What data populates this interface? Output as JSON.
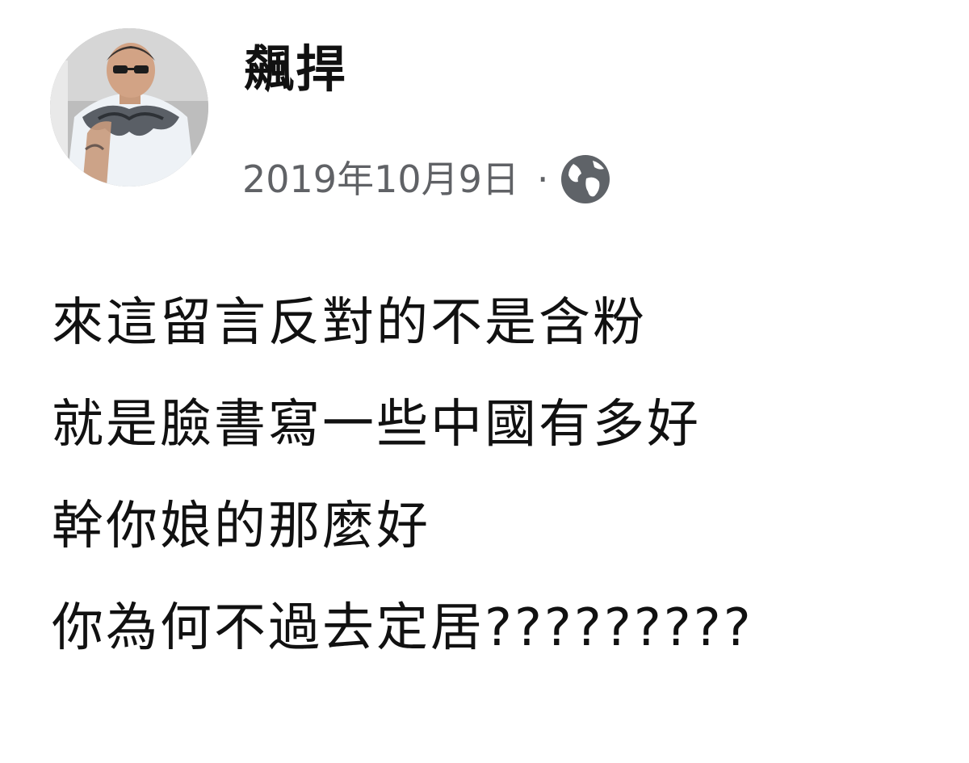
{
  "post": {
    "author_name": "飆捍",
    "timestamp": "2019年10月9日",
    "separator": "·",
    "privacy_icon": "globe-icon",
    "body_lines": [
      "來這留言反對的不是含粉",
      "就是臉書寫一些中國有多好",
      "幹你娘的那麼好",
      "你為何不過去定居?????????"
    ]
  },
  "colors": {
    "text": "#111111",
    "meta": "#606266",
    "background": "#ffffff"
  }
}
